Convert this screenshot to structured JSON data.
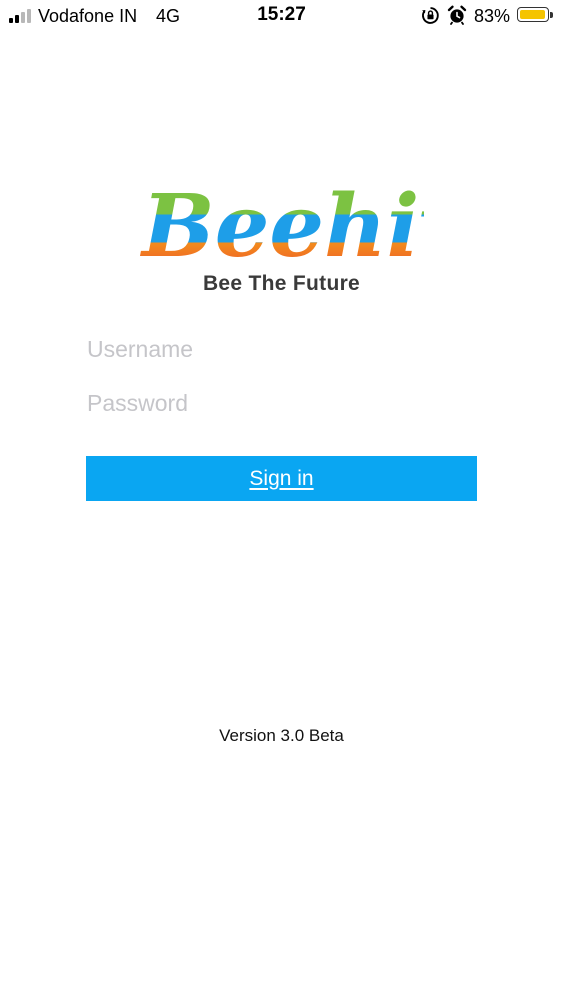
{
  "status_bar": {
    "carrier": "Vodafone IN",
    "network": "4G",
    "time": "15:27",
    "battery_percent": "83%",
    "battery_level": 0.83,
    "signal_bars_filled": 2,
    "signal_bars_total": 4,
    "icons": [
      "signal-icon",
      "orientation-lock-icon",
      "alarm-icon",
      "battery-icon"
    ]
  },
  "logo": {
    "brand": "Beehive",
    "tagline": "Bee The Future"
  },
  "form": {
    "username_placeholder": "Username",
    "username_value": "",
    "password_placeholder": "Password",
    "password_value": "",
    "signin_label": "Sign in"
  },
  "footer": {
    "version": "Version 3.0 Beta"
  },
  "colors": {
    "primary_button": "#0aa6f2",
    "battery_fill": "#f5c400",
    "logo_green": "#7cc242",
    "logo_blue": "#1e9ee8",
    "logo_orange": "#f28c1c",
    "logo_red": "#ee4d2d",
    "logo_yellow": "#f8c51c",
    "placeholder": "#c5c5c9"
  }
}
